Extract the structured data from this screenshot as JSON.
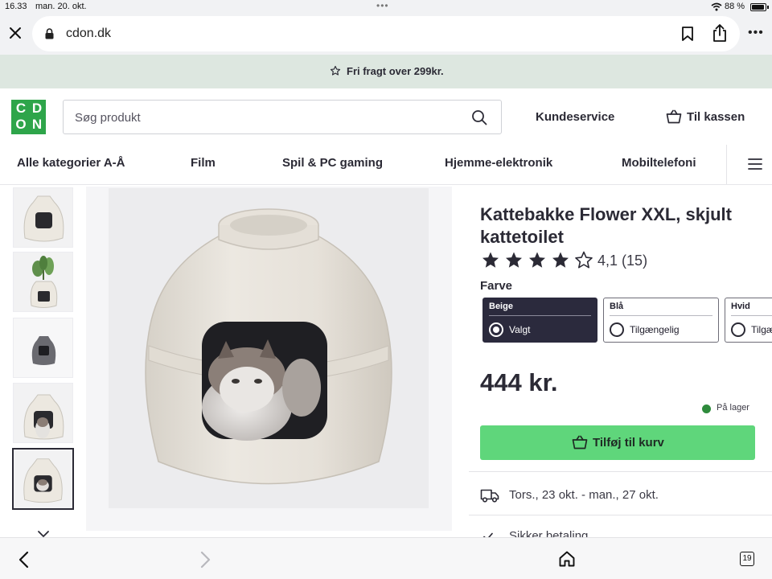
{
  "status": {
    "time": "16.33",
    "date": "man. 20. okt.",
    "dots": "•••",
    "battery": "88 %"
  },
  "browser": {
    "url": "cdon.dk",
    "tab_count": "19"
  },
  "promo": {
    "text": "Fri fragt over 299kr."
  },
  "header": {
    "logo_letters": [
      "C",
      "D",
      "O",
      "N"
    ],
    "search_placeholder": "Søg produkt",
    "customer_service": "Kundeservice",
    "checkout": "Til kassen"
  },
  "nav": {
    "items": [
      "Alle kategorier A-Å",
      "Film",
      "Spil & PC gaming",
      "Hjemme-elektronik",
      "Mobiltelefoni"
    ]
  },
  "product": {
    "title": "Kattebakke Flower XXL, skjult kattetoilet",
    "rating_value": 4.1,
    "rating_text": "4,1",
    "review_count": "(15)",
    "color_label": "Farve",
    "colors": [
      {
        "name": "Beige",
        "status": "Valgt",
        "selected": true
      },
      {
        "name": "Blå",
        "status": "Tilgængelig",
        "selected": false
      },
      {
        "name": "Hvid",
        "status": "Tilgængelig",
        "selected": false
      }
    ],
    "price": "444 kr.",
    "stock": "På lager",
    "add_to_cart": "Tilføj til kurv",
    "delivery": "Tors., 23 okt. - man., 27 okt.",
    "secure_payment": "Sikker betaling"
  },
  "colors": {
    "brand_green": "#2ea54a",
    "cta_green": "#5fd67b",
    "dark": "#2b2a3d",
    "promo_bg": "#dde7e0",
    "stock_dot": "#2e8b3c"
  }
}
